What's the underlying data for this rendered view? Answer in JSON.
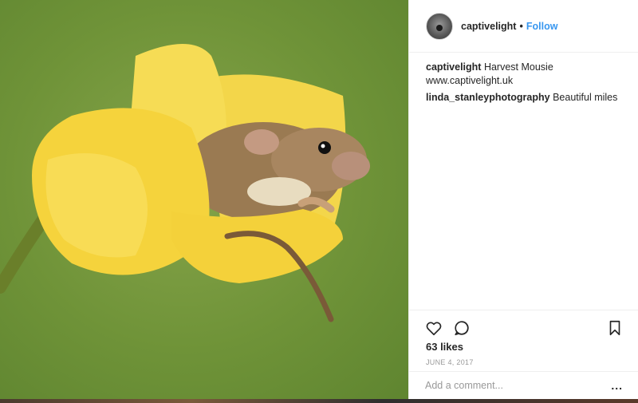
{
  "post": {
    "image_alt": "harvest mouse in yellow tulip",
    "header": {
      "username": "captivelight",
      "separator": "•",
      "follow_label": "Follow"
    },
    "comments": [
      {
        "username": "captivelight",
        "text": "Harvest Mousie www.captivelight.uk"
      },
      {
        "username": "linda_stanleyphotography",
        "text": "Beautiful miles"
      }
    ],
    "actions": {
      "like_icon": "heart-icon",
      "comment_icon": "comment-bubble-icon",
      "save_icon": "bookmark-icon"
    },
    "likes": "63 likes",
    "date": "JUNE 4, 2017",
    "comment_box": {
      "placeholder": "Add a comment...",
      "more_label": "..."
    }
  }
}
